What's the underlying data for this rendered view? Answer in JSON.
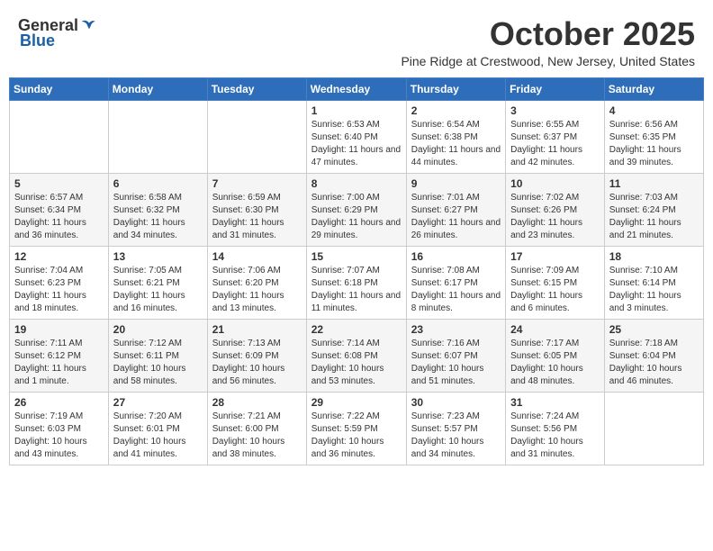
{
  "logo": {
    "general": "General",
    "blue": "Blue"
  },
  "title": "October 2025",
  "subtitle": "Pine Ridge at Crestwood, New Jersey, United States",
  "days_header": [
    "Sunday",
    "Monday",
    "Tuesday",
    "Wednesday",
    "Thursday",
    "Friday",
    "Saturday"
  ],
  "weeks": [
    [
      {
        "day": "",
        "info": ""
      },
      {
        "day": "",
        "info": ""
      },
      {
        "day": "",
        "info": ""
      },
      {
        "day": "1",
        "info": "Sunrise: 6:53 AM\nSunset: 6:40 PM\nDaylight: 11 hours and 47 minutes."
      },
      {
        "day": "2",
        "info": "Sunrise: 6:54 AM\nSunset: 6:38 PM\nDaylight: 11 hours and 44 minutes."
      },
      {
        "day": "3",
        "info": "Sunrise: 6:55 AM\nSunset: 6:37 PM\nDaylight: 11 hours and 42 minutes."
      },
      {
        "day": "4",
        "info": "Sunrise: 6:56 AM\nSunset: 6:35 PM\nDaylight: 11 hours and 39 minutes."
      }
    ],
    [
      {
        "day": "5",
        "info": "Sunrise: 6:57 AM\nSunset: 6:34 PM\nDaylight: 11 hours and 36 minutes."
      },
      {
        "day": "6",
        "info": "Sunrise: 6:58 AM\nSunset: 6:32 PM\nDaylight: 11 hours and 34 minutes."
      },
      {
        "day": "7",
        "info": "Sunrise: 6:59 AM\nSunset: 6:30 PM\nDaylight: 11 hours and 31 minutes."
      },
      {
        "day": "8",
        "info": "Sunrise: 7:00 AM\nSunset: 6:29 PM\nDaylight: 11 hours and 29 minutes."
      },
      {
        "day": "9",
        "info": "Sunrise: 7:01 AM\nSunset: 6:27 PM\nDaylight: 11 hours and 26 minutes."
      },
      {
        "day": "10",
        "info": "Sunrise: 7:02 AM\nSunset: 6:26 PM\nDaylight: 11 hours and 23 minutes."
      },
      {
        "day": "11",
        "info": "Sunrise: 7:03 AM\nSunset: 6:24 PM\nDaylight: 11 hours and 21 minutes."
      }
    ],
    [
      {
        "day": "12",
        "info": "Sunrise: 7:04 AM\nSunset: 6:23 PM\nDaylight: 11 hours and 18 minutes."
      },
      {
        "day": "13",
        "info": "Sunrise: 7:05 AM\nSunset: 6:21 PM\nDaylight: 11 hours and 16 minutes."
      },
      {
        "day": "14",
        "info": "Sunrise: 7:06 AM\nSunset: 6:20 PM\nDaylight: 11 hours and 13 minutes."
      },
      {
        "day": "15",
        "info": "Sunrise: 7:07 AM\nSunset: 6:18 PM\nDaylight: 11 hours and 11 minutes."
      },
      {
        "day": "16",
        "info": "Sunrise: 7:08 AM\nSunset: 6:17 PM\nDaylight: 11 hours and 8 minutes."
      },
      {
        "day": "17",
        "info": "Sunrise: 7:09 AM\nSunset: 6:15 PM\nDaylight: 11 hours and 6 minutes."
      },
      {
        "day": "18",
        "info": "Sunrise: 7:10 AM\nSunset: 6:14 PM\nDaylight: 11 hours and 3 minutes."
      }
    ],
    [
      {
        "day": "19",
        "info": "Sunrise: 7:11 AM\nSunset: 6:12 PM\nDaylight: 11 hours and 1 minute."
      },
      {
        "day": "20",
        "info": "Sunrise: 7:12 AM\nSunset: 6:11 PM\nDaylight: 10 hours and 58 minutes."
      },
      {
        "day": "21",
        "info": "Sunrise: 7:13 AM\nSunset: 6:09 PM\nDaylight: 10 hours and 56 minutes."
      },
      {
        "day": "22",
        "info": "Sunrise: 7:14 AM\nSunset: 6:08 PM\nDaylight: 10 hours and 53 minutes."
      },
      {
        "day": "23",
        "info": "Sunrise: 7:16 AM\nSunset: 6:07 PM\nDaylight: 10 hours and 51 minutes."
      },
      {
        "day": "24",
        "info": "Sunrise: 7:17 AM\nSunset: 6:05 PM\nDaylight: 10 hours and 48 minutes."
      },
      {
        "day": "25",
        "info": "Sunrise: 7:18 AM\nSunset: 6:04 PM\nDaylight: 10 hours and 46 minutes."
      }
    ],
    [
      {
        "day": "26",
        "info": "Sunrise: 7:19 AM\nSunset: 6:03 PM\nDaylight: 10 hours and 43 minutes."
      },
      {
        "day": "27",
        "info": "Sunrise: 7:20 AM\nSunset: 6:01 PM\nDaylight: 10 hours and 41 minutes."
      },
      {
        "day": "28",
        "info": "Sunrise: 7:21 AM\nSunset: 6:00 PM\nDaylight: 10 hours and 38 minutes."
      },
      {
        "day": "29",
        "info": "Sunrise: 7:22 AM\nSunset: 5:59 PM\nDaylight: 10 hours and 36 minutes."
      },
      {
        "day": "30",
        "info": "Sunrise: 7:23 AM\nSunset: 5:57 PM\nDaylight: 10 hours and 34 minutes."
      },
      {
        "day": "31",
        "info": "Sunrise: 7:24 AM\nSunset: 5:56 PM\nDaylight: 10 hours and 31 minutes."
      },
      {
        "day": "",
        "info": ""
      }
    ]
  ]
}
